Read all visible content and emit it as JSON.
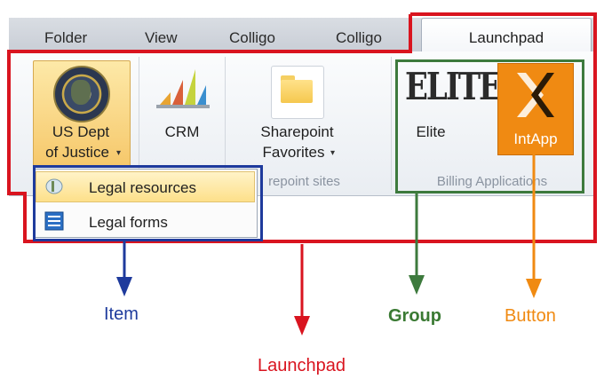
{
  "ribbon": {
    "tabs": [
      "Folder",
      "View",
      "Colligo",
      "Colligo"
    ],
    "active_tab": "Launchpad",
    "buttons": {
      "us_dept": [
        "US Dept",
        "of Justice"
      ],
      "crm": "CRM",
      "sharepoint": [
        "Sharepoint",
        "Favorites"
      ],
      "elite": "Elite",
      "elite_logo": "ELITE",
      "intapp": "IntApp"
    },
    "groups": {
      "sharepoint": "repoint sites",
      "billing": "Billing Applications"
    }
  },
  "dropdown": {
    "items": [
      "Legal resources",
      "Legal forms"
    ]
  },
  "annotations": {
    "item": "Item",
    "launchpad": "Launchpad",
    "group": "Group",
    "button": "Button"
  },
  "colors": {
    "launchpad_frame": "#d9141f",
    "group_frame": "#3d7a3d",
    "item_frame": "#1e3a9c",
    "button_arrow": "#f08a12",
    "intapp_tile": "#f08a12"
  }
}
